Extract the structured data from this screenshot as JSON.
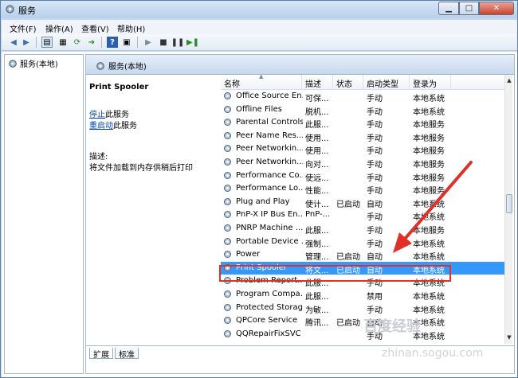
{
  "window": {
    "title": "服务"
  },
  "menu": [
    "文件(F)",
    "操作(A)",
    "查看(V)",
    "帮助(H)"
  ],
  "left_tree": {
    "item": "服务(本地)"
  },
  "right_header": "服务(本地)",
  "detail": {
    "name": "Print Spooler",
    "stop_link": "停止",
    "stop_suffix": "此服务",
    "restart_link": "重启动",
    "restart_suffix": "此服务",
    "desc_label": "描述:",
    "desc_text": "将文件加载到内存供稍后打印"
  },
  "columns": [
    "名称",
    "描述",
    "状态",
    "启动类型",
    "登录为"
  ],
  "rows": [
    {
      "name": "Office Source En...",
      "desc": "可保...",
      "status": "",
      "startup": "手动",
      "logon": "本地系统"
    },
    {
      "name": "Offline Files",
      "desc": "脱机...",
      "status": "",
      "startup": "手动",
      "logon": "本地系统"
    },
    {
      "name": "Parental Controls",
      "desc": "此服...",
      "status": "",
      "startup": "手动",
      "logon": "本地服务"
    },
    {
      "name": "Peer Name Res...",
      "desc": "使用...",
      "status": "",
      "startup": "手动",
      "logon": "本地服务"
    },
    {
      "name": "Peer Networkin...",
      "desc": "使用...",
      "status": "",
      "startup": "手动",
      "logon": "本地服务"
    },
    {
      "name": "Peer Networkin...",
      "desc": "向对...",
      "status": "",
      "startup": "手动",
      "logon": "本地服务"
    },
    {
      "name": "Performance Co...",
      "desc": "使远...",
      "status": "",
      "startup": "手动",
      "logon": "本地服务"
    },
    {
      "name": "Performance Lo...",
      "desc": "性能...",
      "status": "",
      "startup": "手动",
      "logon": "本地服务"
    },
    {
      "name": "Plug and Play",
      "desc": "使计...",
      "status": "已启动",
      "startup": "自动",
      "logon": "本地系统"
    },
    {
      "name": "PnP-X IP Bus En...",
      "desc": "PnP-...",
      "status": "",
      "startup": "手动",
      "logon": "本地系统"
    },
    {
      "name": "PNRP Machine ...",
      "desc": "此服...",
      "status": "",
      "startup": "手动",
      "logon": "本地服务"
    },
    {
      "name": "Portable Device ...",
      "desc": "强制...",
      "status": "",
      "startup": "手动",
      "logon": "本地系统"
    },
    {
      "name": "Power",
      "desc": "管理...",
      "status": "已启动",
      "startup": "自动",
      "logon": "本地系统"
    },
    {
      "name": "Print Spooler",
      "desc": "将文...",
      "status": "已启动",
      "startup": "自动",
      "logon": "本地系统"
    },
    {
      "name": "Problem Report...",
      "desc": "此服...",
      "status": "",
      "startup": "手动",
      "logon": "本地系统"
    },
    {
      "name": "Program Compa...",
      "desc": "此服...",
      "status": "",
      "startup": "禁用",
      "logon": "本地系统"
    },
    {
      "name": "Protected Storage",
      "desc": "为敏...",
      "status": "",
      "startup": "手动",
      "logon": "本地系统"
    },
    {
      "name": "QPCore Service",
      "desc": "腾讯...",
      "status": "已启动",
      "startup": "自动",
      "logon": "本地系统"
    },
    {
      "name": "QQRepairFixSVC",
      "desc": "",
      "status": "",
      "startup": "手动",
      "logon": "本地系统"
    }
  ],
  "selected_index": 13,
  "tabs": [
    "扩展",
    "标准"
  ],
  "watermark": {
    "line1": "百度经验",
    "line2": "zhinan.sogou.com"
  },
  "colors": {
    "selection": "#3399ff",
    "highlight_box": "#e0302a",
    "arrow": "#e0302a"
  }
}
